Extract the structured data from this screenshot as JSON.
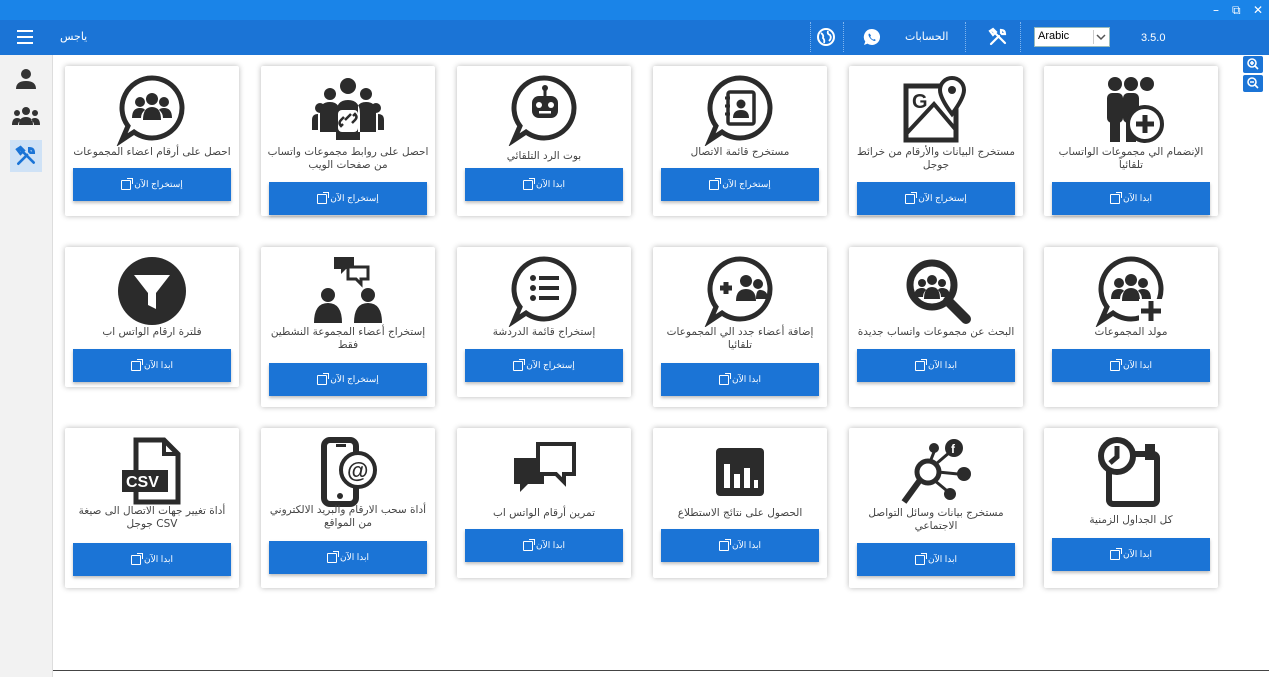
{
  "window": {
    "minimize_glyph": "–",
    "restore_glyph": "⧉",
    "close_glyph": "✕"
  },
  "topbar": {
    "app_name": "ياجس",
    "accounts_label": "الحسابات",
    "language": "Arabic",
    "version": "3.5.0",
    "icons": [
      "globe-icon",
      "whatsapp-icon",
      "tools-icon",
      "hamburger-icon"
    ]
  },
  "sidebar": {
    "items": [
      {
        "name": "user-icon"
      },
      {
        "name": "group-icon"
      },
      {
        "name": "tools-icon",
        "active": true
      }
    ]
  },
  "zoom": {
    "in": "zoom-in-icon",
    "out": "zoom-out-icon"
  },
  "cards": [
    {
      "title": "الإنضمام الي مجموعات الواتساب تلقائياً",
      "button": "ابدا الآن",
      "icon": "join-groups-icon"
    },
    {
      "title": "مستخرج البيانات والأرقام من خرائط جوجل",
      "button": "إستخراج الآن",
      "icon": "google-maps-icon"
    },
    {
      "title": "مستخرج قائمة الاتصال",
      "button": "إستخراج الآن",
      "icon": "contacts-book-icon"
    },
    {
      "title": "بوت الرد التلقائي",
      "button": "ابدا الآن",
      "icon": "robot-chat-icon"
    },
    {
      "title": "احصل على روابط مجموعات واتساب من صفحات الويب",
      "button": "إستخراج الآن",
      "icon": "group-links-icon"
    },
    {
      "title": "احصل على أرقام اعضاء المجموعات",
      "button": "إستخراج الآن",
      "icon": "group-members-chat-icon"
    },
    {
      "title": "مولد المجموعات",
      "button": "ابدا الآن",
      "icon": "group-generator-icon"
    },
    {
      "title": "البحث عن مجموعات واتساب جديدة",
      "button": "ابدا الآن",
      "icon": "search-groups-icon"
    },
    {
      "title": "إضافة أعضاء جدد الي المجموعات تلقائيا",
      "button": "ابدا الآن",
      "icon": "add-members-chat-icon"
    },
    {
      "title": "إستخراج قائمة الدردشة",
      "button": "إستخراج الآن",
      "icon": "chat-list-icon"
    },
    {
      "title": "إستخراج أعضاء المجموعة النشطين فقط",
      "button": "إستخراج الآن",
      "icon": "active-members-icon"
    },
    {
      "title": "فلترة ارقام الواتس اب",
      "button": "ابدا الآن",
      "icon": "filter-icon"
    },
    {
      "title": "كل الجداول الزمنية",
      "button": "ابدا الآن",
      "icon": "schedule-clock-icon"
    },
    {
      "title": "مستخرج بيانات وسائل التواصل الاجتماعي",
      "button": "ابدا الآن",
      "icon": "social-media-search-icon"
    },
    {
      "title": "الحصول على نتائج الاستطلاع",
      "button": "ابدا الآن",
      "icon": "poll-results-icon"
    },
    {
      "title": "تمرين أرقام الواتس اب",
      "button": "ابدا الآن",
      "icon": "warmup-chat-icon"
    },
    {
      "title": "أداة سحب الارقام والبريد الالكتروني من المواقع",
      "button": "ابدا الآن",
      "icon": "phone-email-icon"
    },
    {
      "title": "أداة تغيير جهات الاتصال الى صيغة CSV جوجل",
      "button": "ابدا الآن",
      "icon": "csv-file-icon"
    }
  ],
  "csv_label": "CSV",
  "colors": {
    "titlebar": "#1a84e8",
    "topbar": "#1b74d6",
    "button": "#1b74d6",
    "icon": "#2b2b2b"
  }
}
